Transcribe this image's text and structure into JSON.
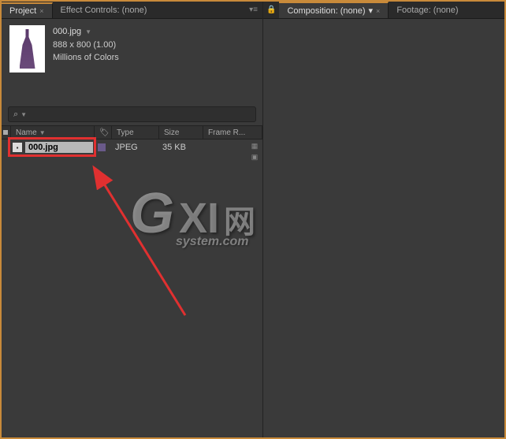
{
  "tabs": {
    "left": [
      {
        "label": "Project",
        "active": true
      },
      {
        "label": "Effect Controls: (none)",
        "active": false
      }
    ],
    "right": [
      {
        "label": "Composition: (none)",
        "active": true
      },
      {
        "label": "Footage: (none)",
        "active": false
      }
    ]
  },
  "file_info": {
    "name": "000.jpg",
    "dims": "888 x 800 (1.00)",
    "colors": "Millions of Colors"
  },
  "columns": {
    "name": "Name",
    "tag": "",
    "type": "Type",
    "size": "Size",
    "frame_rate": "Frame R..."
  },
  "assets": [
    {
      "name": "000.jpg",
      "type": "JPEG",
      "size": "35 KB"
    }
  ],
  "watermark": {
    "g": "G",
    "xi": "XI",
    "wang": "网",
    "sub": "system.com"
  }
}
